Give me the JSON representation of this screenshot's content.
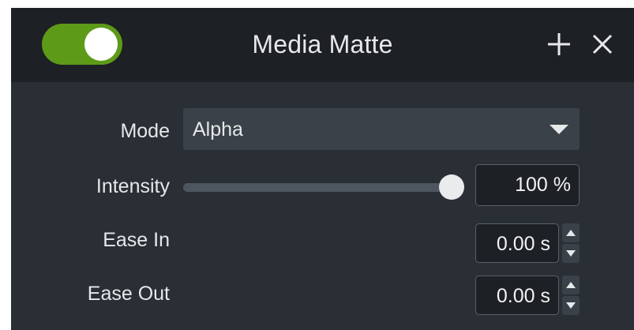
{
  "panel": {
    "title": "Media Matte",
    "enabled": true,
    "colors": {
      "toggle_on": "#5d9a18",
      "header_bg": "#1d2024",
      "body_bg": "#2a2f35"
    }
  },
  "header": {
    "add_icon": "plus-icon",
    "close_icon": "close-icon"
  },
  "mode": {
    "label": "Mode",
    "value": "Alpha",
    "icon": "chevron-down-icon"
  },
  "intensity": {
    "label": "Intensity",
    "value": "100",
    "unit": "%",
    "display": "100 %",
    "slider_fraction": 1.0
  },
  "ease_in": {
    "label": "Ease In",
    "display": "0.00 s"
  },
  "ease_out": {
    "label": "Ease Out",
    "display": "0.00 s"
  }
}
